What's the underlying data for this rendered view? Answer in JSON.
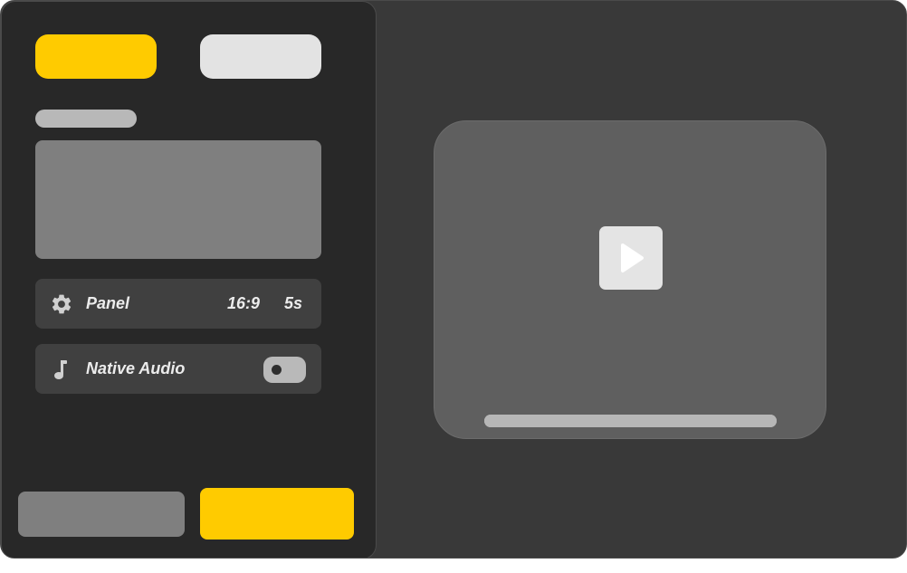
{
  "sidebar": {
    "settings_row": {
      "icon": "gear-icon",
      "label": "Panel",
      "aspect_ratio": "16:9",
      "duration": "5s"
    },
    "audio_row": {
      "icon": "music-note-icon",
      "label": "Native Audio",
      "toggle_on": false
    }
  },
  "preview": {
    "play_icon": "play-icon",
    "progress": 1.0
  },
  "colors": {
    "accent": "#ffcb00",
    "panel_bg": "#282828",
    "app_bg": "#393939",
    "preview_bg": "#5f5f5f"
  }
}
